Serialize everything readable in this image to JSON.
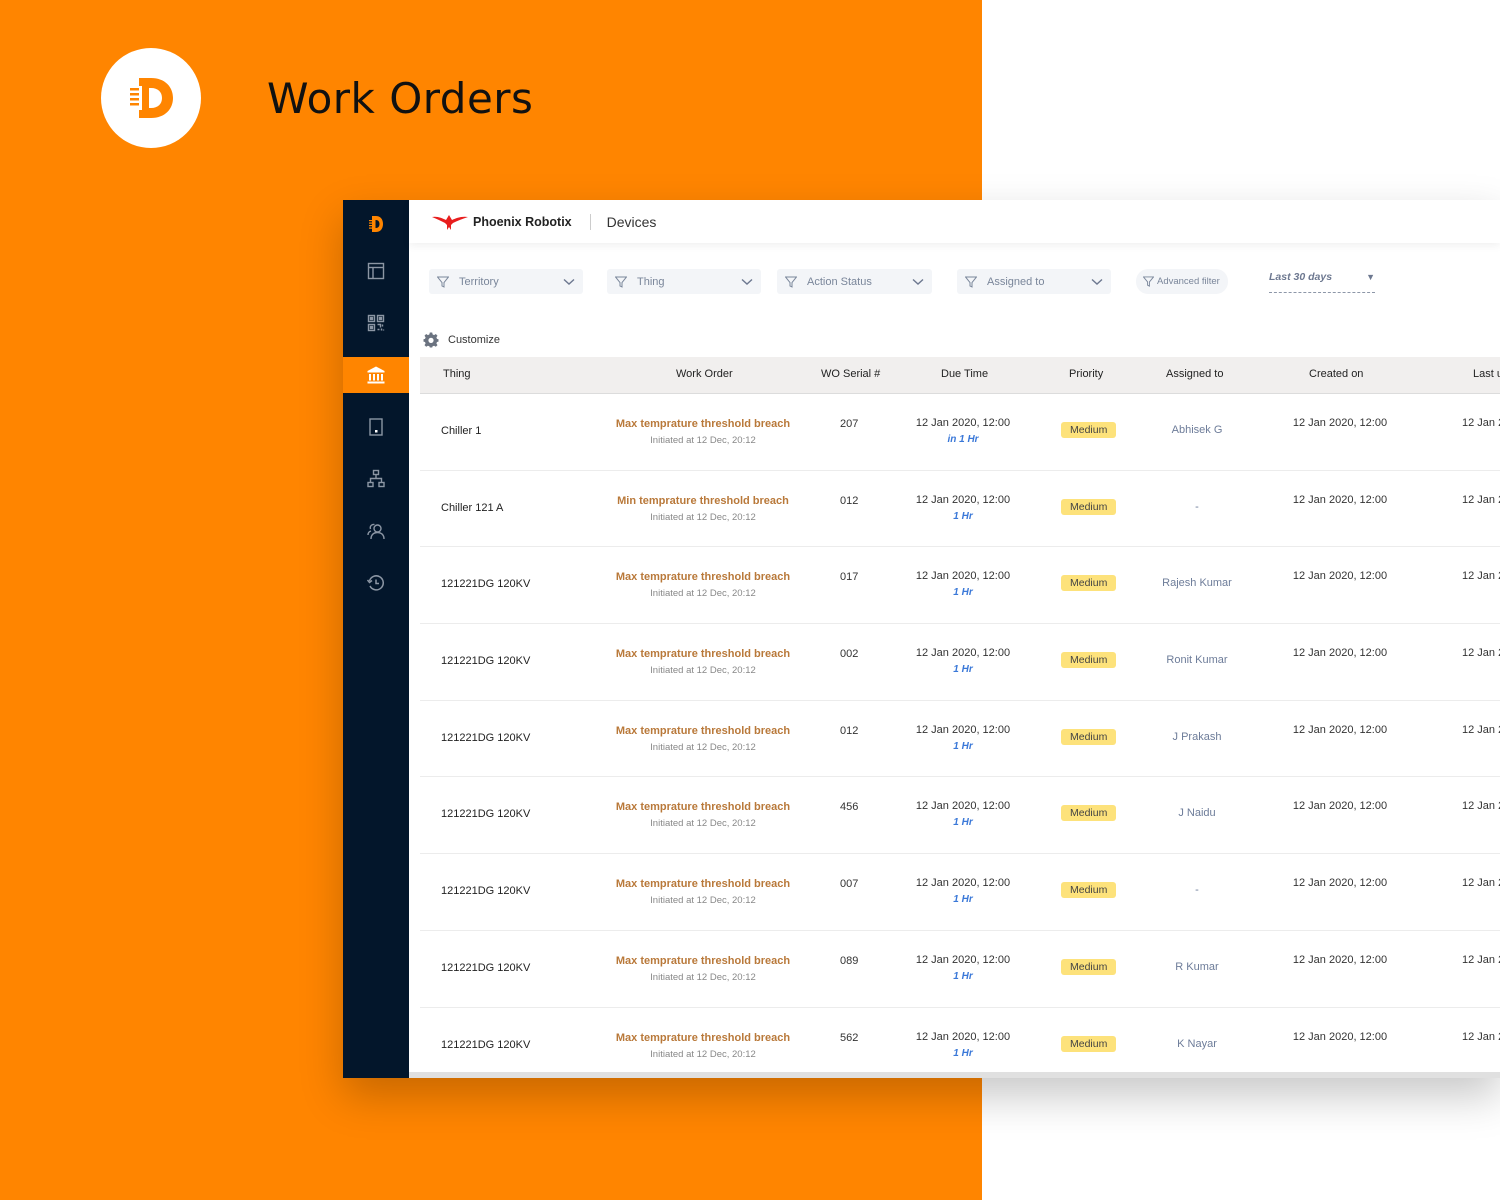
{
  "hero": {
    "title": "Work Orders"
  },
  "colors": {
    "accent": "#ff8500",
    "sidebar": "#03162b",
    "wo_title": "#b9793a",
    "due_relative": "#3a78d8",
    "priority_badge": "#fde27b"
  },
  "topbar": {
    "org_name": "Phoenix Robotix",
    "section": "Devices"
  },
  "sidebar": {
    "items": [
      {
        "name": "logo",
        "icon": "d-logo-icon"
      },
      {
        "name": "dashboard",
        "icon": "layout-icon"
      },
      {
        "name": "qr-codes",
        "icon": "qr-code-icon"
      },
      {
        "name": "work-orders",
        "icon": "bank-icon",
        "active": true
      },
      {
        "name": "devices",
        "icon": "device-icon"
      },
      {
        "name": "hierarchy",
        "icon": "hierarchy-icon"
      },
      {
        "name": "users",
        "icon": "users-icon"
      },
      {
        "name": "history",
        "icon": "history-icon"
      }
    ]
  },
  "filters": {
    "territory": "Territory",
    "thing": "Thing",
    "action_status": "Action Status",
    "assigned_to": "Assigned to",
    "advanced": "Advanced filter",
    "date_range": "Last 30 days"
  },
  "customize_label": "Customize",
  "table": {
    "headers": {
      "thing": "Thing",
      "work_order": "Work Order",
      "serial": "WO Serial #",
      "due_time": "Due Time",
      "priority": "Priority",
      "assigned_to": "Assigned to",
      "created_on": "Created on",
      "last_updated": "Last u"
    },
    "rows": [
      {
        "thing": "Chiller 1",
        "wo_title": "Max temprature threshold breach",
        "wo_sub": "Initiated at 12 Dec, 20:12",
        "serial": "207",
        "due_date": "12 Jan 2020, 12:00",
        "due_rel": "in 1 Hr",
        "priority": "Medium",
        "assigned": "Abhisek G",
        "created": "12 Jan 2020, 12:00",
        "last": "12 Jan 2"
      },
      {
        "thing": "Chiller 121 A",
        "wo_title": "Min temprature threshold breach",
        "wo_sub": "Initiated at 12 Dec, 20:12",
        "serial": "012",
        "due_date": "12 Jan 2020, 12:00",
        "due_rel": "1 Hr",
        "priority": "Medium",
        "assigned": "-",
        "created": "12 Jan 2020, 12:00",
        "last": "12 Jan 2"
      },
      {
        "thing": "121221DG 120KV",
        "wo_title": "Max temprature threshold breach",
        "wo_sub": "Initiated at 12 Dec, 20:12",
        "serial": "017",
        "due_date": "12 Jan 2020, 12:00",
        "due_rel": "1 Hr",
        "priority": "Medium",
        "assigned": "Rajesh Kumar",
        "created": "12 Jan 2020, 12:00",
        "last": "12 Jan 2"
      },
      {
        "thing": "121221DG 120KV",
        "wo_title": "Max temprature threshold breach",
        "wo_sub": "Initiated at 12 Dec, 20:12",
        "serial": "002",
        "due_date": "12 Jan 2020, 12:00",
        "due_rel": "1 Hr",
        "priority": "Medium",
        "assigned": "Ronit Kumar",
        "created": "12 Jan 2020, 12:00",
        "last": "12 Jan 2"
      },
      {
        "thing": "121221DG 120KV",
        "wo_title": "Max temprature threshold breach",
        "wo_sub": "Initiated at 12 Dec, 20:12",
        "serial": "012",
        "due_date": "12 Jan 2020, 12:00",
        "due_rel": "1 Hr",
        "priority": "Medium",
        "assigned": "J Prakash",
        "created": "12 Jan 2020, 12:00",
        "last": "12 Jan 2"
      },
      {
        "thing": "121221DG 120KV",
        "wo_title": "Max temprature threshold breach",
        "wo_sub": "Initiated at 12 Dec, 20:12",
        "serial": "456",
        "due_date": "12 Jan 2020, 12:00",
        "due_rel": "1 Hr",
        "priority": "Medium",
        "assigned": "J Naidu",
        "created": "12 Jan 2020, 12:00",
        "last": "12 Jan 2"
      },
      {
        "thing": "121221DG 120KV",
        "wo_title": "Max temprature threshold breach",
        "wo_sub": "Initiated at 12 Dec, 20:12",
        "serial": "007",
        "due_date": "12 Jan 2020, 12:00",
        "due_rel": "1 Hr",
        "priority": "Medium",
        "assigned": "-",
        "created": "12 Jan 2020, 12:00",
        "last": "12 Jan 2"
      },
      {
        "thing": "121221DG 120KV",
        "wo_title": "Max temprature threshold breach",
        "wo_sub": "Initiated at 12 Dec, 20:12",
        "serial": "089",
        "due_date": "12 Jan 2020, 12:00",
        "due_rel": "1 Hr",
        "priority": "Medium",
        "assigned": "R Kumar",
        "created": "12 Jan 2020, 12:00",
        "last": "12 Jan 2"
      },
      {
        "thing": "121221DG 120KV",
        "wo_title": "Max temprature threshold breach",
        "wo_sub": "Initiated at 12 Dec, 20:12",
        "serial": "562",
        "due_date": "12 Jan 2020, 12:00",
        "due_rel": "1 Hr",
        "priority": "Medium",
        "assigned": "K Nayar",
        "created": "12 Jan 2020, 12:00",
        "last": "12 Jan 2"
      }
    ]
  }
}
